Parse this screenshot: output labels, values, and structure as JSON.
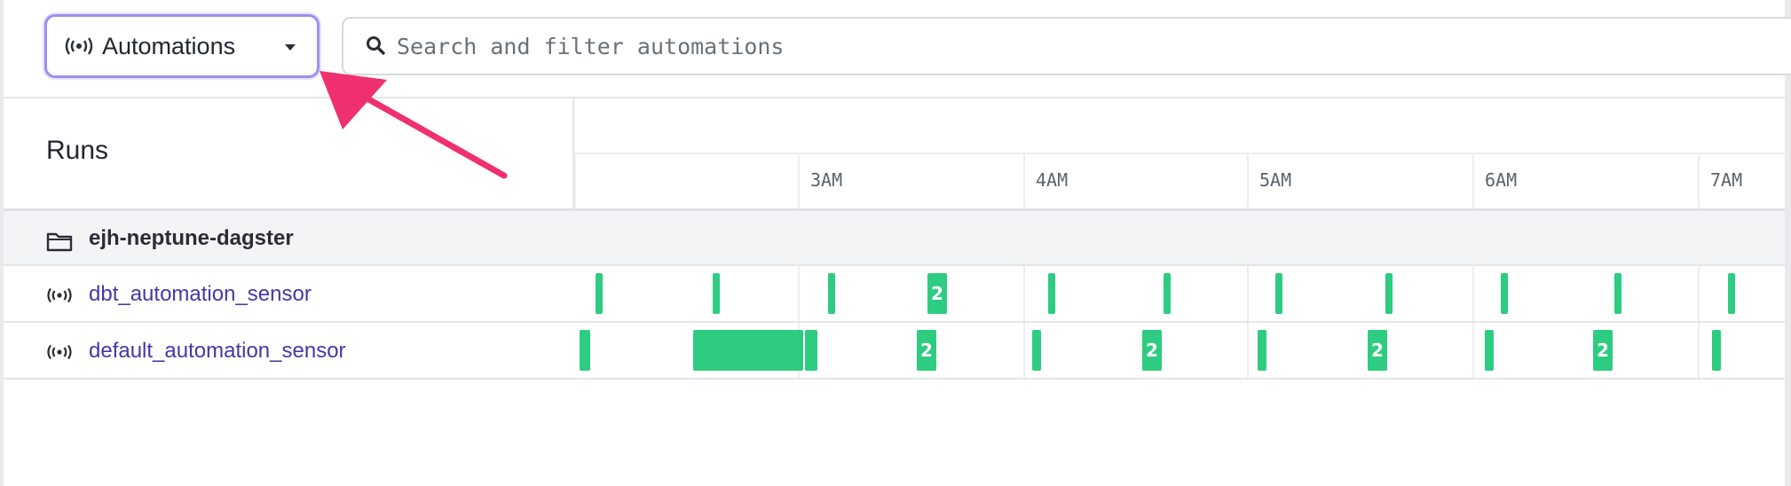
{
  "toolbar": {
    "view_selector": {
      "label": "Automations",
      "icon": "sensor-icon"
    },
    "search": {
      "placeholder": "Search and filter automations",
      "value": ""
    }
  },
  "colors": {
    "accent_border": "#9f8df0",
    "run_success": "#2ecc81",
    "link": "#4438a8",
    "annotation_arrow": "#f0306e"
  },
  "timeline": {
    "runs_label": "Runs",
    "hours": [
      "3AM",
      "4AM",
      "5AM",
      "6AM",
      "7AM"
    ]
  },
  "group": {
    "name": "ejh-neptune-dagster",
    "icon": "folder-icon"
  },
  "sensors": [
    {
      "name": "dbt_automation_sensor",
      "icon": "sensor-icon",
      "run_counts": [
        "2"
      ]
    },
    {
      "name": "default_automation_sensor",
      "icon": "sensor-icon",
      "run_counts": [
        "2",
        "2",
        "2",
        "2"
      ]
    }
  ]
}
